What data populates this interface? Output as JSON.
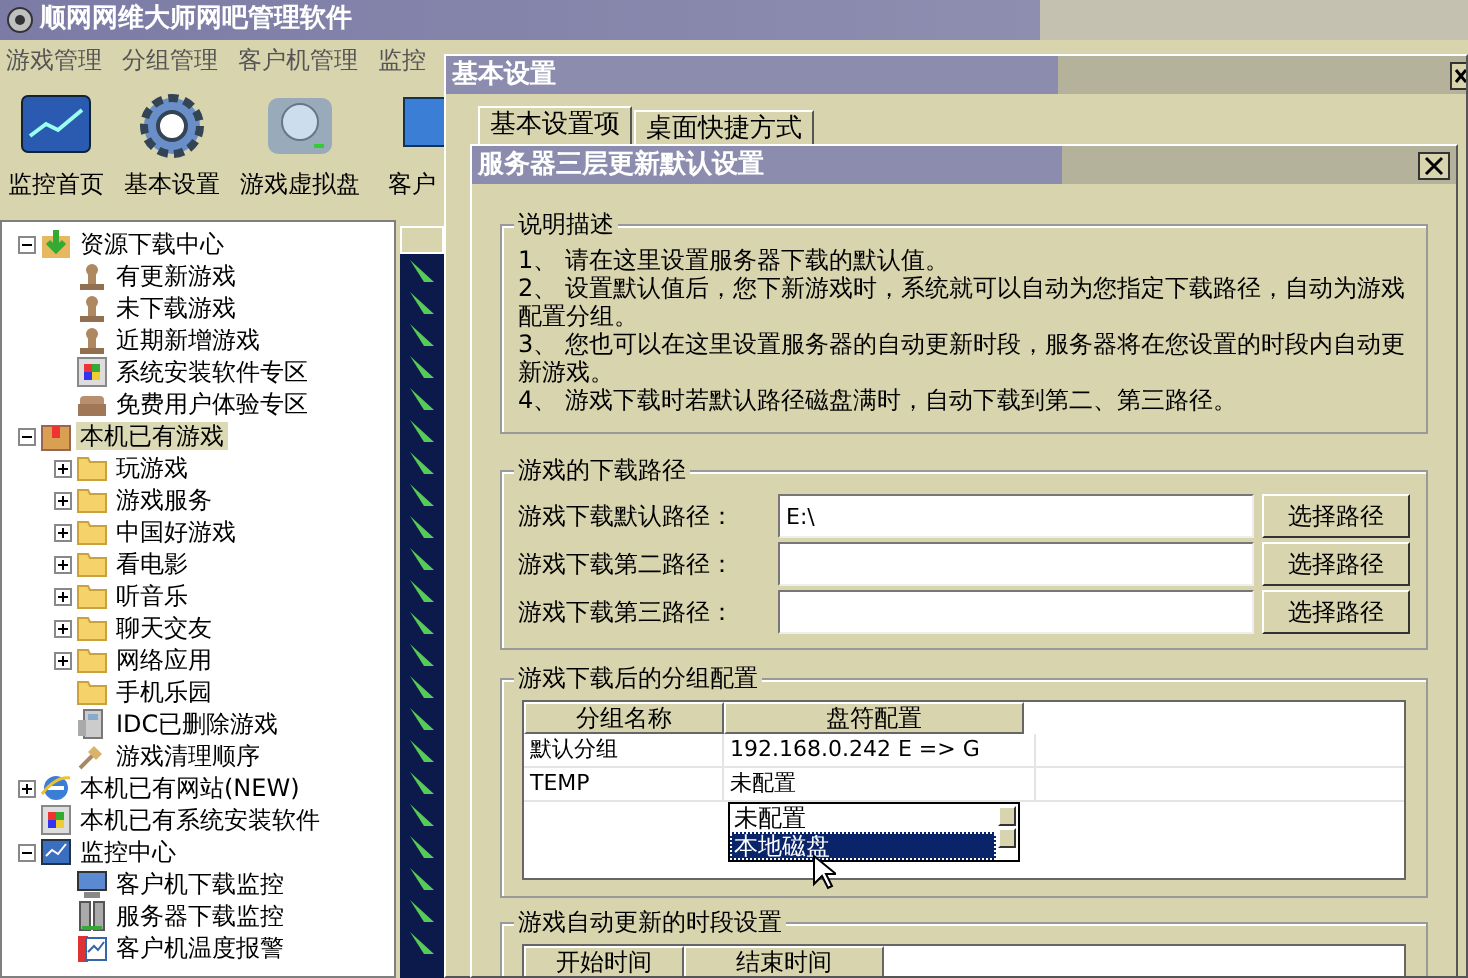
{
  "app": {
    "title": "顺网网维大师网吧管理软件"
  },
  "menu": [
    {
      "label": "游戏管理"
    },
    {
      "label": "分组管理"
    },
    {
      "label": "客户机管理"
    },
    {
      "label": "监控"
    }
  ],
  "toolbar": [
    {
      "label": "监控首页",
      "kind": "monitor"
    },
    {
      "label": "基本设置",
      "kind": "gear"
    },
    {
      "label": "游戏虚拟盘",
      "kind": "disk"
    },
    {
      "label": "客户",
      "kind": "client"
    }
  ],
  "tree": [
    {
      "label": "资源下载中心",
      "kind": "download",
      "expanded": true,
      "selected": false,
      "children": [
        {
          "label": "有更新游戏",
          "kind": "user",
          "selected": false
        },
        {
          "label": "未下载游戏",
          "kind": "user",
          "selected": false
        },
        {
          "label": "近期新增游戏",
          "kind": "user",
          "selected": false
        },
        {
          "label": "系统安装软件专区",
          "kind": "software",
          "selected": false
        },
        {
          "label": "免费用户体验专区",
          "kind": "sofa",
          "selected": false
        }
      ]
    },
    {
      "label": "本机已有游戏",
      "kind": "box",
      "expanded": true,
      "selected": true,
      "children": [
        {
          "label": "玩游戏",
          "kind": "folder",
          "expanded": false,
          "selected": false
        },
        {
          "label": "游戏服务",
          "kind": "folder",
          "expanded": false,
          "selected": false
        },
        {
          "label": "中国好游戏",
          "kind": "folder",
          "expanded": false,
          "selected": false
        },
        {
          "label": "看电影",
          "kind": "folder",
          "expanded": false,
          "selected": false
        },
        {
          "label": "听音乐",
          "kind": "folder",
          "expanded": false,
          "selected": false
        },
        {
          "label": "聊天交友",
          "kind": "folder",
          "expanded": false,
          "selected": false
        },
        {
          "label": "网络应用",
          "kind": "folder",
          "expanded": false,
          "selected": false
        },
        {
          "label": "手机乐园",
          "kind": "folder",
          "selected": false
        },
        {
          "label": "IDC已删除游戏",
          "kind": "device",
          "selected": false
        },
        {
          "label": "游戏清理顺序",
          "kind": "broom",
          "selected": false
        }
      ]
    },
    {
      "label": "本机已有网站(NEW)",
      "kind": "browser",
      "expanded": false,
      "selected": false
    },
    {
      "label": "本机已有系统安装软件",
      "kind": "software",
      "selected": false
    },
    {
      "label": "监控中心",
      "kind": "monitor",
      "expanded": true,
      "selected": false,
      "children": [
        {
          "label": "客户机下载监控",
          "kind": "pc",
          "selected": false
        },
        {
          "label": "服务器下载监控",
          "kind": "server",
          "selected": false
        },
        {
          "label": "客户机温度报警",
          "kind": "alarm",
          "selected": false
        }
      ]
    }
  ],
  "settings_dialog": {
    "title": "基本设置",
    "tabs": [
      {
        "label": "基本设置项",
        "selected": true
      },
      {
        "label": "桌面快捷方式",
        "selected": false
      }
    ]
  },
  "update_dialog": {
    "title": "服务器三层更新默认设置",
    "description": {
      "title": "说明描述",
      "lines": [
        "1、 请在这里设置服务器下载的默认值。",
        "2、 设置默认值后，您下新游戏时，系统就可以自动为您指定下载路径，自动为游戏配置分组。",
        "3、 您也可以在这里设置服务器的自动更新时段，服务器将在您设置的时段内自动更新游戏。",
        "4、 游戏下载时若默认路径磁盘满时，自动下载到第二、第三路径。"
      ]
    },
    "paths": {
      "title": "游戏的下载路径",
      "rows": [
        {
          "label": "游戏下载默认路径：",
          "value": "E:\\",
          "button": "选择路径"
        },
        {
          "label": "游戏下载第二路径：",
          "value": "",
          "button": "选择路径"
        },
        {
          "label": "游戏下载第三路径：",
          "value": "",
          "button": "选择路径"
        }
      ]
    },
    "groups": {
      "title": "游戏下载后的分组配置",
      "columns": [
        "分组名称",
        "盘符配置"
      ],
      "rows": [
        [
          "默认分组",
          "192.168.0.242 E => G"
        ],
        [
          "TEMP",
          "未配置"
        ]
      ],
      "dropdown": {
        "options": [
          {
            "label": "未配置",
            "selected": false
          },
          {
            "label": "本地磁盘",
            "selected": true
          }
        ]
      }
    },
    "schedule": {
      "title": "游戏自动更新的时段设置",
      "columns": [
        "开始时间",
        "结束时间"
      ]
    }
  }
}
